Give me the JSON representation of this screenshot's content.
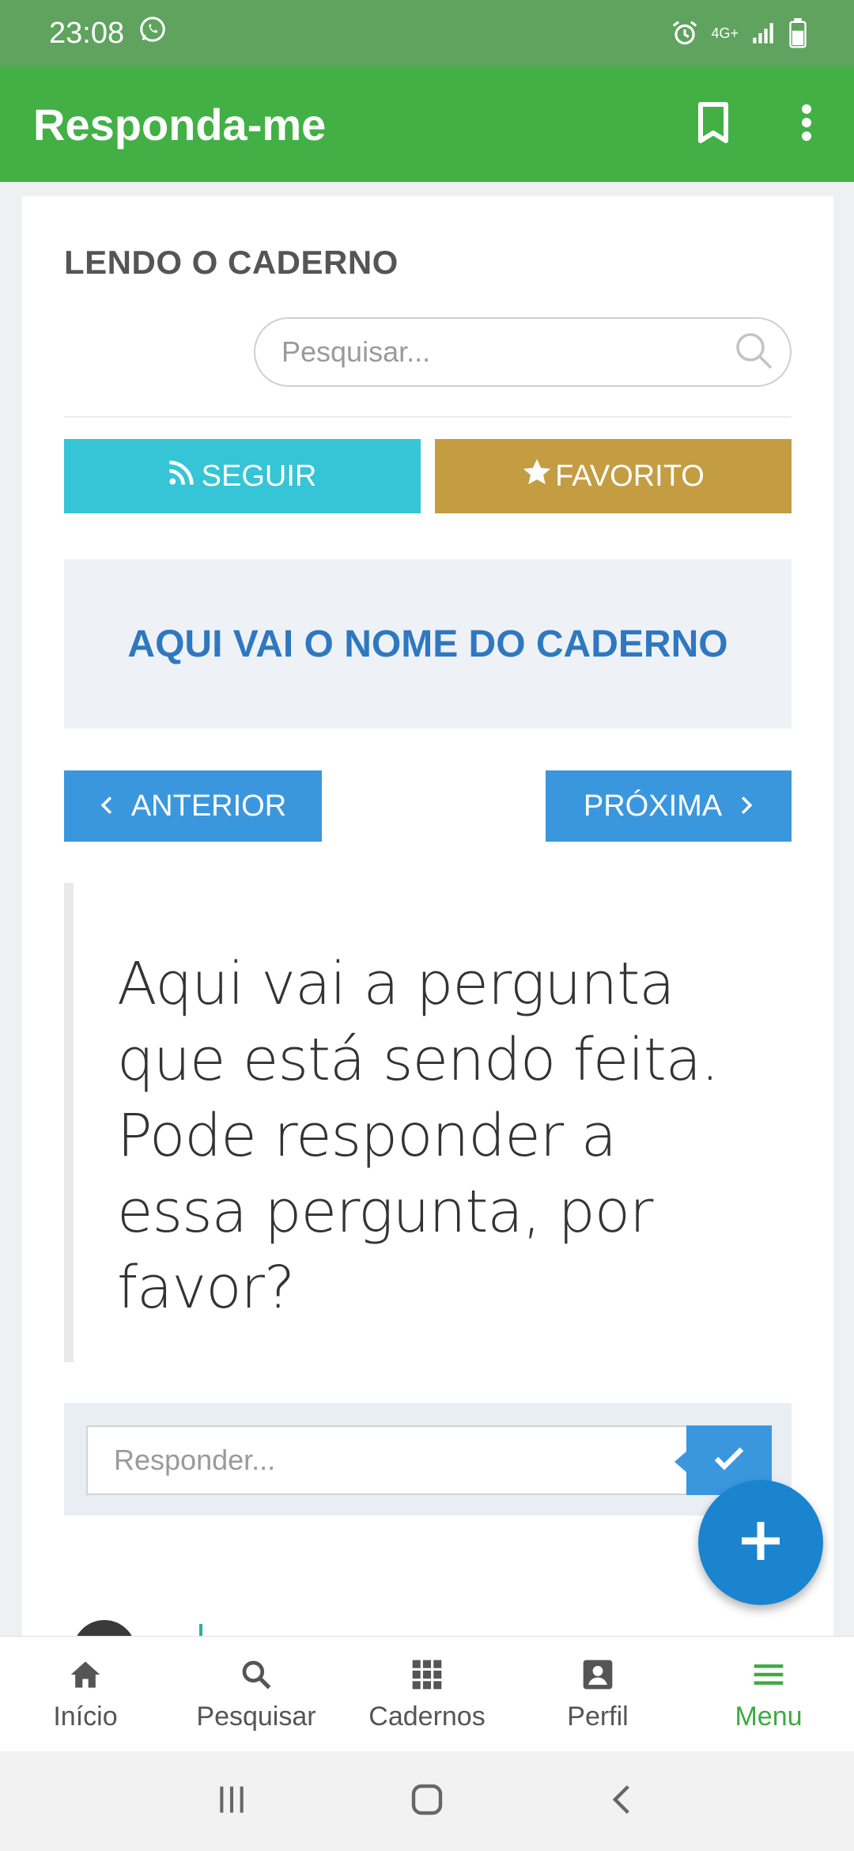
{
  "status_bar": {
    "time": "23:08",
    "network": "4G+"
  },
  "app_bar": {
    "title": "Responda-me"
  },
  "page": {
    "heading": "LENDO O CADERNO",
    "search": {
      "placeholder": "Pesquisar..."
    },
    "follow_label": "SEGUIR",
    "favorite_label": "FAVORITO",
    "notebook_name": "AQUI VAI O NOME DO CADERNO",
    "prev_label": "ANTERIOR",
    "next_label": "PRÓXIMA",
    "question": "Aqui vai a pergunta que está sendo feita. Pode responder a essa pergunta, por favor?",
    "answer": {
      "placeholder": "Responder..."
    }
  },
  "bottom_nav": {
    "items": [
      {
        "label": "Início",
        "icon": "home-icon"
      },
      {
        "label": "Pesquisar",
        "icon": "search-icon"
      },
      {
        "label": "Cadernos",
        "icon": "grid-icon"
      },
      {
        "label": "Perfil",
        "icon": "profile-icon"
      },
      {
        "label": "Menu",
        "icon": "menu-icon",
        "active": true
      }
    ]
  },
  "colors": {
    "app_bar": "#43b046",
    "follow": "#35c5d6",
    "favorite": "#c49c42",
    "primary_blue": "#3a97de",
    "fab": "#1a84cf",
    "active_nav": "#3da940"
  }
}
